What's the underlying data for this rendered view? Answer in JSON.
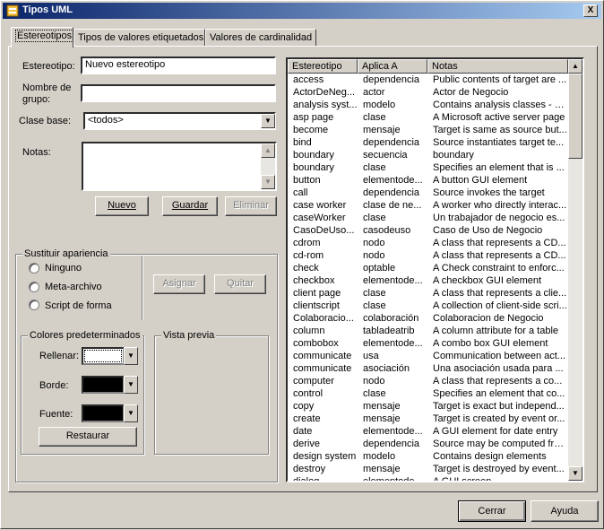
{
  "window": {
    "title": "Tipos UML",
    "close": "X"
  },
  "tabs": [
    {
      "label": "Estereotipos"
    },
    {
      "label": "Tipos de valores etiquetados"
    },
    {
      "label": "Valores de cardinalidad"
    }
  ],
  "form": {
    "stereotype_label": "Estereotipo:",
    "stereotype_value": "Nuevo estereotipo",
    "group_label_1": "Nombre de",
    "group_label_2": "grupo:",
    "group_value": "",
    "base_label": "Clase base:",
    "base_value": "<todos>",
    "notes_label": "Notas:",
    "notes_value": ""
  },
  "buttons": {
    "new": "Nuevo",
    "save": "Guardar",
    "delete": "Eliminar",
    "assign": "Asignar",
    "remove": "Quitar",
    "restore": "Restaurar",
    "close": "Cerrar",
    "help": "Ayuda"
  },
  "appearance": {
    "title": "Sustituir apariencia",
    "options": [
      "Ninguno",
      "Meta-archivo",
      "Script de forma"
    ]
  },
  "colors": {
    "title": "Colores predeterminados",
    "fill_label": "Rellenar:",
    "border_label": "Borde:",
    "font_label": "Fuente:",
    "fill_color": "#ffffff",
    "border_color": "#000000",
    "font_color": "#000000"
  },
  "preview": {
    "title": "Vista previa"
  },
  "list": {
    "headers": [
      "Estereotipo",
      "Aplica A",
      "Notas"
    ],
    "rows": [
      [
        "access",
        "dependencia",
        "Public contents of target are ..."
      ],
      [
        "ActorDeNeg...",
        "actor",
        "Actor de Negocio"
      ],
      [
        "analysis syst...",
        "modelo",
        "Contains analysis classes - e..."
      ],
      [
        "asp page",
        "clase",
        "A Microsoft active server page"
      ],
      [
        "become",
        "mensaje",
        "Target is same as source but..."
      ],
      [
        "bind",
        "dependencia",
        "Source instantiates target te..."
      ],
      [
        "boundary",
        "secuencia",
        "boundary"
      ],
      [
        "boundary",
        "clase",
        "Specifies an element that is ..."
      ],
      [
        "button",
        "elementode...",
        "A button GUI element"
      ],
      [
        "call",
        "dependencia",
        "Source invokes the target"
      ],
      [
        "case worker",
        "clase de ne...",
        "A worker who directly interac..."
      ],
      [
        "caseWorker",
        "clase",
        "Un trabajador de negocio es..."
      ],
      [
        "CasoDeUso...",
        "casodeuso",
        "Caso de Uso de Negocio"
      ],
      [
        "cdrom",
        "nodo",
        "A class that represents a CD..."
      ],
      [
        "cd-rom",
        "nodo",
        "A class that represents a CD..."
      ],
      [
        "check",
        "optable",
        "A Check constraint to enforc..."
      ],
      [
        "checkbox",
        "elementode...",
        "A checkbox GUI element"
      ],
      [
        "client page",
        "clase",
        "A class that represents a clie..."
      ],
      [
        "clientscript",
        "clase",
        "A collection of client-side scri..."
      ],
      [
        "Colaboracio...",
        "colaboración",
        "Colaboracion de Negocio"
      ],
      [
        "column",
        "tabladeatrib",
        "A column attribute for a table"
      ],
      [
        "combobox",
        "elementode...",
        "A combo box GUI element"
      ],
      [
        "communicate",
        "usa",
        "Communication between act..."
      ],
      [
        "communicate",
        "asociación",
        "Una asociación usada para ..."
      ],
      [
        "computer",
        "nodo",
        "A class that represents a co..."
      ],
      [
        "control",
        "clase",
        "Specifies an element that co..."
      ],
      [
        "copy",
        "mensaje",
        "Target is exact but independ..."
      ],
      [
        "create",
        "mensaje",
        "Target is created by event or..."
      ],
      [
        "date",
        "elementode...",
        "A GUI element for date entry"
      ],
      [
        "derive",
        "dependencia",
        "Source may be computed fro..."
      ],
      [
        "design system",
        "modelo",
        "Contains design elements"
      ],
      [
        "destroy",
        "mensaje",
        "Target is destroyed by event..."
      ],
      [
        "dialog",
        "elementode...",
        "A GUI screen"
      ]
    ]
  }
}
